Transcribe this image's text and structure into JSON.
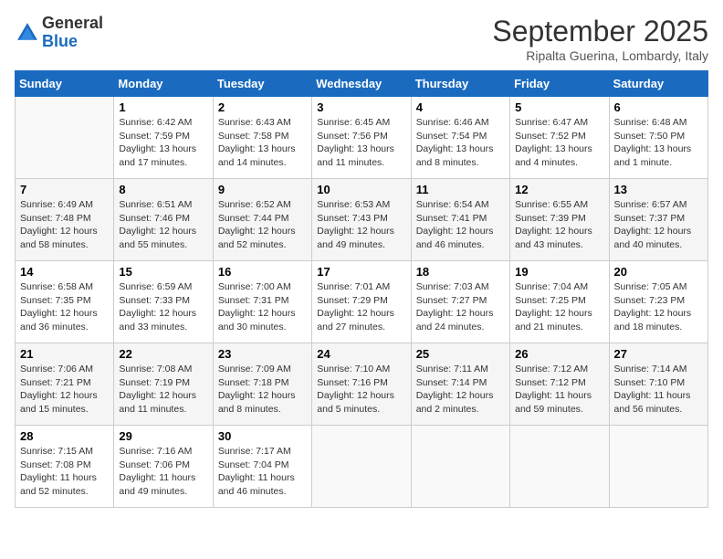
{
  "logo": {
    "general": "General",
    "blue": "Blue"
  },
  "title": "September 2025",
  "location": "Ripalta Guerina, Lombardy, Italy",
  "days_of_week": [
    "Sunday",
    "Monday",
    "Tuesday",
    "Wednesday",
    "Thursday",
    "Friday",
    "Saturday"
  ],
  "weeks": [
    [
      {
        "day": "",
        "sunrise": "",
        "sunset": "",
        "daylight": ""
      },
      {
        "day": "1",
        "sunrise": "Sunrise: 6:42 AM",
        "sunset": "Sunset: 7:59 PM",
        "daylight": "Daylight: 13 hours and 17 minutes."
      },
      {
        "day": "2",
        "sunrise": "Sunrise: 6:43 AM",
        "sunset": "Sunset: 7:58 PM",
        "daylight": "Daylight: 13 hours and 14 minutes."
      },
      {
        "day": "3",
        "sunrise": "Sunrise: 6:45 AM",
        "sunset": "Sunset: 7:56 PM",
        "daylight": "Daylight: 13 hours and 11 minutes."
      },
      {
        "day": "4",
        "sunrise": "Sunrise: 6:46 AM",
        "sunset": "Sunset: 7:54 PM",
        "daylight": "Daylight: 13 hours and 8 minutes."
      },
      {
        "day": "5",
        "sunrise": "Sunrise: 6:47 AM",
        "sunset": "Sunset: 7:52 PM",
        "daylight": "Daylight: 13 hours and 4 minutes."
      },
      {
        "day": "6",
        "sunrise": "Sunrise: 6:48 AM",
        "sunset": "Sunset: 7:50 PM",
        "daylight": "Daylight: 13 hours and 1 minute."
      }
    ],
    [
      {
        "day": "7",
        "sunrise": "Sunrise: 6:49 AM",
        "sunset": "Sunset: 7:48 PM",
        "daylight": "Daylight: 12 hours and 58 minutes."
      },
      {
        "day": "8",
        "sunrise": "Sunrise: 6:51 AM",
        "sunset": "Sunset: 7:46 PM",
        "daylight": "Daylight: 12 hours and 55 minutes."
      },
      {
        "day": "9",
        "sunrise": "Sunrise: 6:52 AM",
        "sunset": "Sunset: 7:44 PM",
        "daylight": "Daylight: 12 hours and 52 minutes."
      },
      {
        "day": "10",
        "sunrise": "Sunrise: 6:53 AM",
        "sunset": "Sunset: 7:43 PM",
        "daylight": "Daylight: 12 hours and 49 minutes."
      },
      {
        "day": "11",
        "sunrise": "Sunrise: 6:54 AM",
        "sunset": "Sunset: 7:41 PM",
        "daylight": "Daylight: 12 hours and 46 minutes."
      },
      {
        "day": "12",
        "sunrise": "Sunrise: 6:55 AM",
        "sunset": "Sunset: 7:39 PM",
        "daylight": "Daylight: 12 hours and 43 minutes."
      },
      {
        "day": "13",
        "sunrise": "Sunrise: 6:57 AM",
        "sunset": "Sunset: 7:37 PM",
        "daylight": "Daylight: 12 hours and 40 minutes."
      }
    ],
    [
      {
        "day": "14",
        "sunrise": "Sunrise: 6:58 AM",
        "sunset": "Sunset: 7:35 PM",
        "daylight": "Daylight: 12 hours and 36 minutes."
      },
      {
        "day": "15",
        "sunrise": "Sunrise: 6:59 AM",
        "sunset": "Sunset: 7:33 PM",
        "daylight": "Daylight: 12 hours and 33 minutes."
      },
      {
        "day": "16",
        "sunrise": "Sunrise: 7:00 AM",
        "sunset": "Sunset: 7:31 PM",
        "daylight": "Daylight: 12 hours and 30 minutes."
      },
      {
        "day": "17",
        "sunrise": "Sunrise: 7:01 AM",
        "sunset": "Sunset: 7:29 PM",
        "daylight": "Daylight: 12 hours and 27 minutes."
      },
      {
        "day": "18",
        "sunrise": "Sunrise: 7:03 AM",
        "sunset": "Sunset: 7:27 PM",
        "daylight": "Daylight: 12 hours and 24 minutes."
      },
      {
        "day": "19",
        "sunrise": "Sunrise: 7:04 AM",
        "sunset": "Sunset: 7:25 PM",
        "daylight": "Daylight: 12 hours and 21 minutes."
      },
      {
        "day": "20",
        "sunrise": "Sunrise: 7:05 AM",
        "sunset": "Sunset: 7:23 PM",
        "daylight": "Daylight: 12 hours and 18 minutes."
      }
    ],
    [
      {
        "day": "21",
        "sunrise": "Sunrise: 7:06 AM",
        "sunset": "Sunset: 7:21 PM",
        "daylight": "Daylight: 12 hours and 15 minutes."
      },
      {
        "day": "22",
        "sunrise": "Sunrise: 7:08 AM",
        "sunset": "Sunset: 7:19 PM",
        "daylight": "Daylight: 12 hours and 11 minutes."
      },
      {
        "day": "23",
        "sunrise": "Sunrise: 7:09 AM",
        "sunset": "Sunset: 7:18 PM",
        "daylight": "Daylight: 12 hours and 8 minutes."
      },
      {
        "day": "24",
        "sunrise": "Sunrise: 7:10 AM",
        "sunset": "Sunset: 7:16 PM",
        "daylight": "Daylight: 12 hours and 5 minutes."
      },
      {
        "day": "25",
        "sunrise": "Sunrise: 7:11 AM",
        "sunset": "Sunset: 7:14 PM",
        "daylight": "Daylight: 12 hours and 2 minutes."
      },
      {
        "day": "26",
        "sunrise": "Sunrise: 7:12 AM",
        "sunset": "Sunset: 7:12 PM",
        "daylight": "Daylight: 11 hours and 59 minutes."
      },
      {
        "day": "27",
        "sunrise": "Sunrise: 7:14 AM",
        "sunset": "Sunset: 7:10 PM",
        "daylight": "Daylight: 11 hours and 56 minutes."
      }
    ],
    [
      {
        "day": "28",
        "sunrise": "Sunrise: 7:15 AM",
        "sunset": "Sunset: 7:08 PM",
        "daylight": "Daylight: 11 hours and 52 minutes."
      },
      {
        "day": "29",
        "sunrise": "Sunrise: 7:16 AM",
        "sunset": "Sunset: 7:06 PM",
        "daylight": "Daylight: 11 hours and 49 minutes."
      },
      {
        "day": "30",
        "sunrise": "Sunrise: 7:17 AM",
        "sunset": "Sunset: 7:04 PM",
        "daylight": "Daylight: 11 hours and 46 minutes."
      },
      {
        "day": "",
        "sunrise": "",
        "sunset": "",
        "daylight": ""
      },
      {
        "day": "",
        "sunrise": "",
        "sunset": "",
        "daylight": ""
      },
      {
        "day": "",
        "sunrise": "",
        "sunset": "",
        "daylight": ""
      },
      {
        "day": "",
        "sunrise": "",
        "sunset": "",
        "daylight": ""
      }
    ]
  ]
}
